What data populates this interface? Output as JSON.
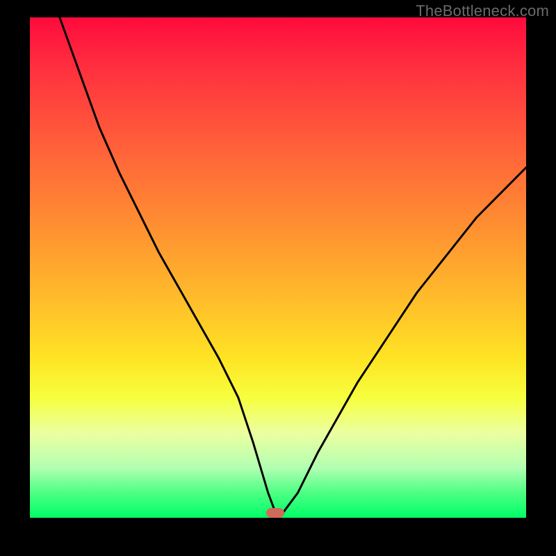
{
  "watermark": "TheBottleneck.com",
  "colors": {
    "curve": "#000000",
    "marker": "#cf6b5a"
  },
  "chart_data": {
    "type": "line",
    "title": "",
    "xlabel": "",
    "ylabel": "",
    "xlim": [
      0,
      100
    ],
    "ylim": [
      0,
      100
    ],
    "grid": false,
    "legend": false,
    "series": [
      {
        "name": "bottleneck-curve",
        "x": [
          6,
          10,
          14,
          18,
          22,
          26,
          30,
          34,
          38,
          42,
          45,
          48,
          49.5,
          51,
          54,
          58,
          62,
          66,
          70,
          74,
          78,
          82,
          86,
          90,
          94,
          98,
          100
        ],
        "y": [
          100,
          89,
          78,
          69,
          61,
          53,
          46,
          39,
          32,
          24,
          15,
          5,
          1,
          1,
          5,
          13,
          20,
          27,
          33,
          39,
          45,
          50,
          55,
          60,
          64,
          68,
          70
        ]
      }
    ],
    "marker": {
      "x": 49.5,
      "y": 1,
      "label": "optimal-point"
    }
  }
}
